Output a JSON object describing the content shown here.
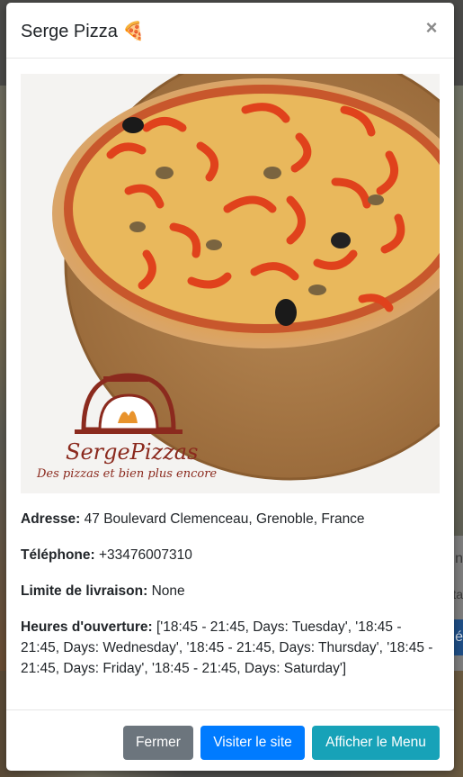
{
  "modal": {
    "title": "Serge Pizza 🍕",
    "close_symbol": "×",
    "image": {
      "logo_text": "SergePizzas",
      "slogan": "Des pizzas et bien plus encore"
    },
    "details": {
      "adresse_label": "Adresse:",
      "adresse_value": "47 Boulevard Clemenceau, Grenoble, France",
      "telephone_label": "Téléphone:",
      "telephone_value": "+33476007310",
      "limite_label": "Limite de livraison:",
      "limite_value": "None",
      "heures_label": "Heures d'ouverture:",
      "heures_value": "['18:45 - 21:45, Days: Tuesday', '18:45 - 21:45, Days: Wednesday', '18:45 - 21:45, Days: Thursday', '18:45 - 21:45, Days: Friday', '18:45 - 21:45, Days: Saturday']"
    },
    "footer": {
      "fermer_label": "Fermer",
      "visiter_label": "Visiter le site",
      "menu_label": "Afficher le Menu"
    }
  },
  "background": {
    "partial_text_1": "n",
    "partial_text_2": "ta",
    "partial_button": "é"
  },
  "colors": {
    "secondary_button": "#6c757d",
    "primary_button": "#007bff",
    "info_button": "#17a2b8",
    "backdrop": "#4a4a48"
  }
}
